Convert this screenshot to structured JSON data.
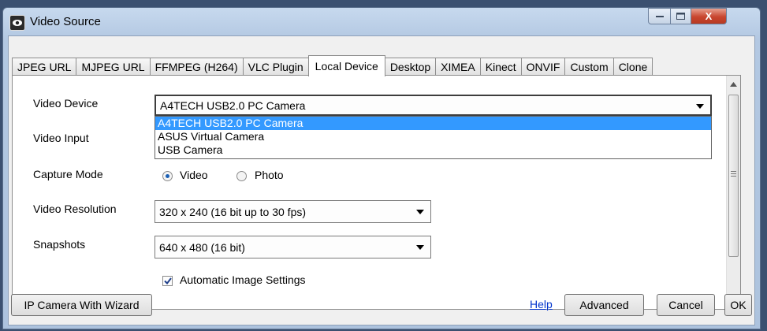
{
  "window": {
    "title": "Video Source",
    "minimize_label": "—",
    "maximize_label": "☐",
    "close_label": "X"
  },
  "tabs": [
    {
      "label": "JPEG URL"
    },
    {
      "label": "MJPEG URL"
    },
    {
      "label": "FFMPEG (H264)"
    },
    {
      "label": "VLC Plugin"
    },
    {
      "label": "Local Device",
      "active": true
    },
    {
      "label": "Desktop"
    },
    {
      "label": "XIMEA"
    },
    {
      "label": "Kinect"
    },
    {
      "label": "ONVIF"
    },
    {
      "label": "Custom"
    },
    {
      "label": "Clone"
    }
  ],
  "form": {
    "video_device": {
      "label": "Video Device",
      "value": "A4TECH USB2.0 PC Camera",
      "options": [
        "A4TECH USB2.0 PC Camera",
        "ASUS Virtual Camera",
        "USB Camera"
      ]
    },
    "video_input": {
      "label": "Video Input"
    },
    "capture_mode": {
      "label": "Capture Mode",
      "option_video": "Video",
      "option_photo": "Photo",
      "selected": "Video"
    },
    "video_resolution": {
      "label": "Video Resolution",
      "value": "320 x 240 (16 bit up to 30 fps)"
    },
    "snapshots": {
      "label": "Snapshots",
      "value": "640 x 480 (16 bit)"
    },
    "automatic_image_settings": {
      "label": "Automatic Image Settings",
      "checked": true
    }
  },
  "footer": {
    "wizard_button": "IP Camera With Wizard",
    "help_link": "Help",
    "advanced_button": "Advanced",
    "cancel_button": "Cancel",
    "ok_button": "OK"
  },
  "colors": {
    "selection": "#3399ff",
    "link": "#0033cc",
    "close_button": "#c8452e"
  }
}
